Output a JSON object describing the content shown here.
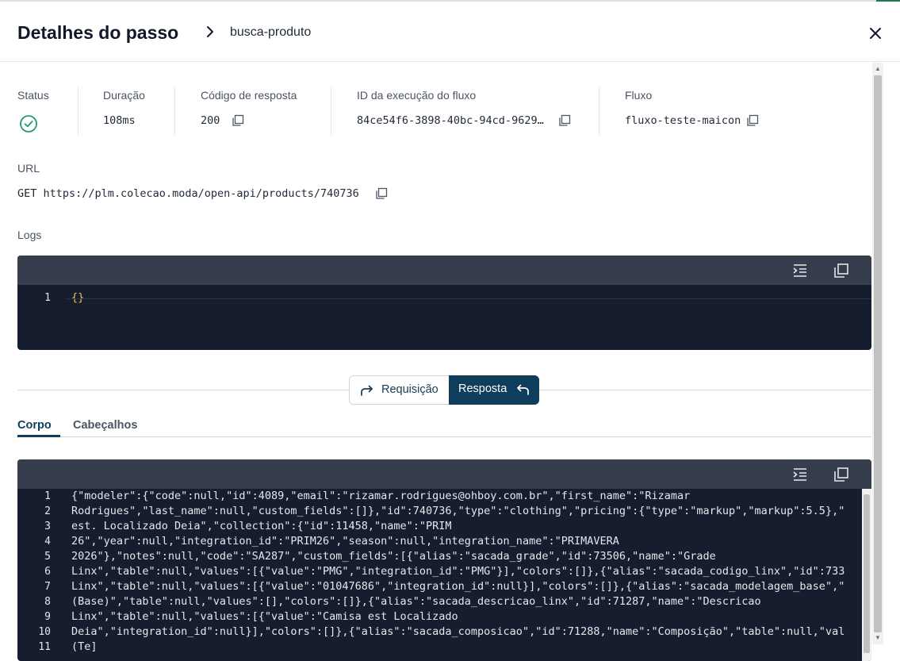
{
  "header": {
    "title": "Detalhes do passo",
    "breadcrumb": "busca-produto"
  },
  "summary": {
    "status_label": "Status",
    "duration_label": "Duração",
    "duration_value": "108ms",
    "code_label": "Código de resposta",
    "code_value": "200",
    "exec_id_label": "ID da execução do fluxo",
    "exec_id_value": "84ce54f6-3898-40bc-94cd-9629…",
    "flow_label": "Fluxo",
    "flow_value": "fluxo-teste-maicon"
  },
  "url": {
    "label": "URL",
    "value": "GET https://plm.colecao.moda/open-api/products/740736"
  },
  "logs": {
    "label": "Logs",
    "lines": [
      {
        "num": "1",
        "text": "{}"
      }
    ]
  },
  "toggle": {
    "request_label": "Requisição",
    "response_label": "Resposta"
  },
  "tabs": {
    "body_label": "Corpo",
    "headers_label": "Cabeçalhos"
  },
  "body_code": {
    "lines": [
      {
        "num": "1",
        "text": "{\"modeler\":{\"code\":null,\"id\":4089,\"email\":\"rizamar.rodrigues@ohboy.com.br\",\"first_name\":\"Rizamar"
      },
      {
        "num": "2",
        "text": "Rodrigues\",\"last_name\":null,\"custom_fields\":[]},\"id\":740736,\"type\":\"clothing\",\"pricing\":{\"type\":\"markup\",\"markup\":5.5},\""
      },
      {
        "num": "3",
        "text": "est. Localizado Deia\",\"collection\":{\"id\":11458,\"name\":\"PRIM"
      },
      {
        "num": "4",
        "text": "26\",\"year\":null,\"integration_id\":\"PRIM26\",\"season\":null,\"integration_name\":\"PRIMAVERA"
      },
      {
        "num": "5",
        "text": "2026\"},\"notes\":null,\"code\":\"SA287\",\"custom_fields\":[{\"alias\":\"sacada_grade\",\"id\":73506,\"name\":\"Grade"
      },
      {
        "num": "6",
        "text": "Linx\",\"table\":null,\"values\":[{\"value\":\"PMG\",\"integration_id\":\"PMG\"}],\"colors\":[]},{\"alias\":\"sacada_codigo_linx\",\"id\":733"
      },
      {
        "num": "7",
        "text": "Linx\",\"table\":null,\"values\":[{\"value\":\"01047686\",\"integration_id\":null}],\"colors\":[]},{\"alias\":\"sacada_modelagem_base\",\""
      },
      {
        "num": "8",
        "text": "(Base)\",\"table\":null,\"values\":[],\"colors\":[]},{\"alias\":\"sacada_descricao_linx\",\"id\":71287,\"name\":\"Descricao"
      },
      {
        "num": "9",
        "text": "Linx\",\"table\":null,\"values\":[{\"value\":\"Camisa est Localizado"
      },
      {
        "num": "10",
        "text": "Deia\",\"integration_id\":null}],\"colors\":[]},{\"alias\":\"sacada_composicao\",\"id\":71288,\"name\":\"Composição\",\"table\":null,\"val"
      },
      {
        "num": "11",
        "text": "(Te]"
      }
    ]
  },
  "colors": {
    "primary": "#0e3e5c",
    "success": "#1f9d6b",
    "code_bg": "#161d2e",
    "toolbar_bg": "#363e4e"
  }
}
